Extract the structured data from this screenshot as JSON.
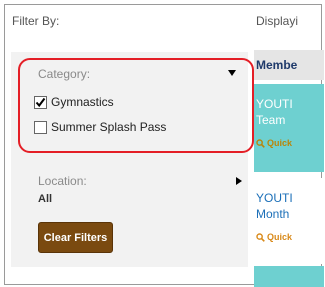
{
  "filter": {
    "heading": "Filter By:",
    "category_label": "Category:",
    "options": [
      {
        "label": "Gymnastics",
        "checked": true
      },
      {
        "label": "Summer Splash Pass",
        "checked": false
      }
    ],
    "location_label": "Location:",
    "location_value": "All",
    "clear_button": "Clear Filters"
  },
  "results": {
    "displaying": "Displayi",
    "header": "Membe",
    "cards": [
      {
        "title_line1": "YOUTI",
        "title_line2": "Team",
        "quick": "Quick"
      },
      {
        "title_line1": "YOUTI",
        "title_line2": "Month",
        "quick": "Quick"
      }
    ]
  },
  "colors": {
    "highlight": "#e41e26",
    "button": "#7a4a10",
    "card_accent": "#6ed0d0",
    "link": "#1b6fb8"
  }
}
